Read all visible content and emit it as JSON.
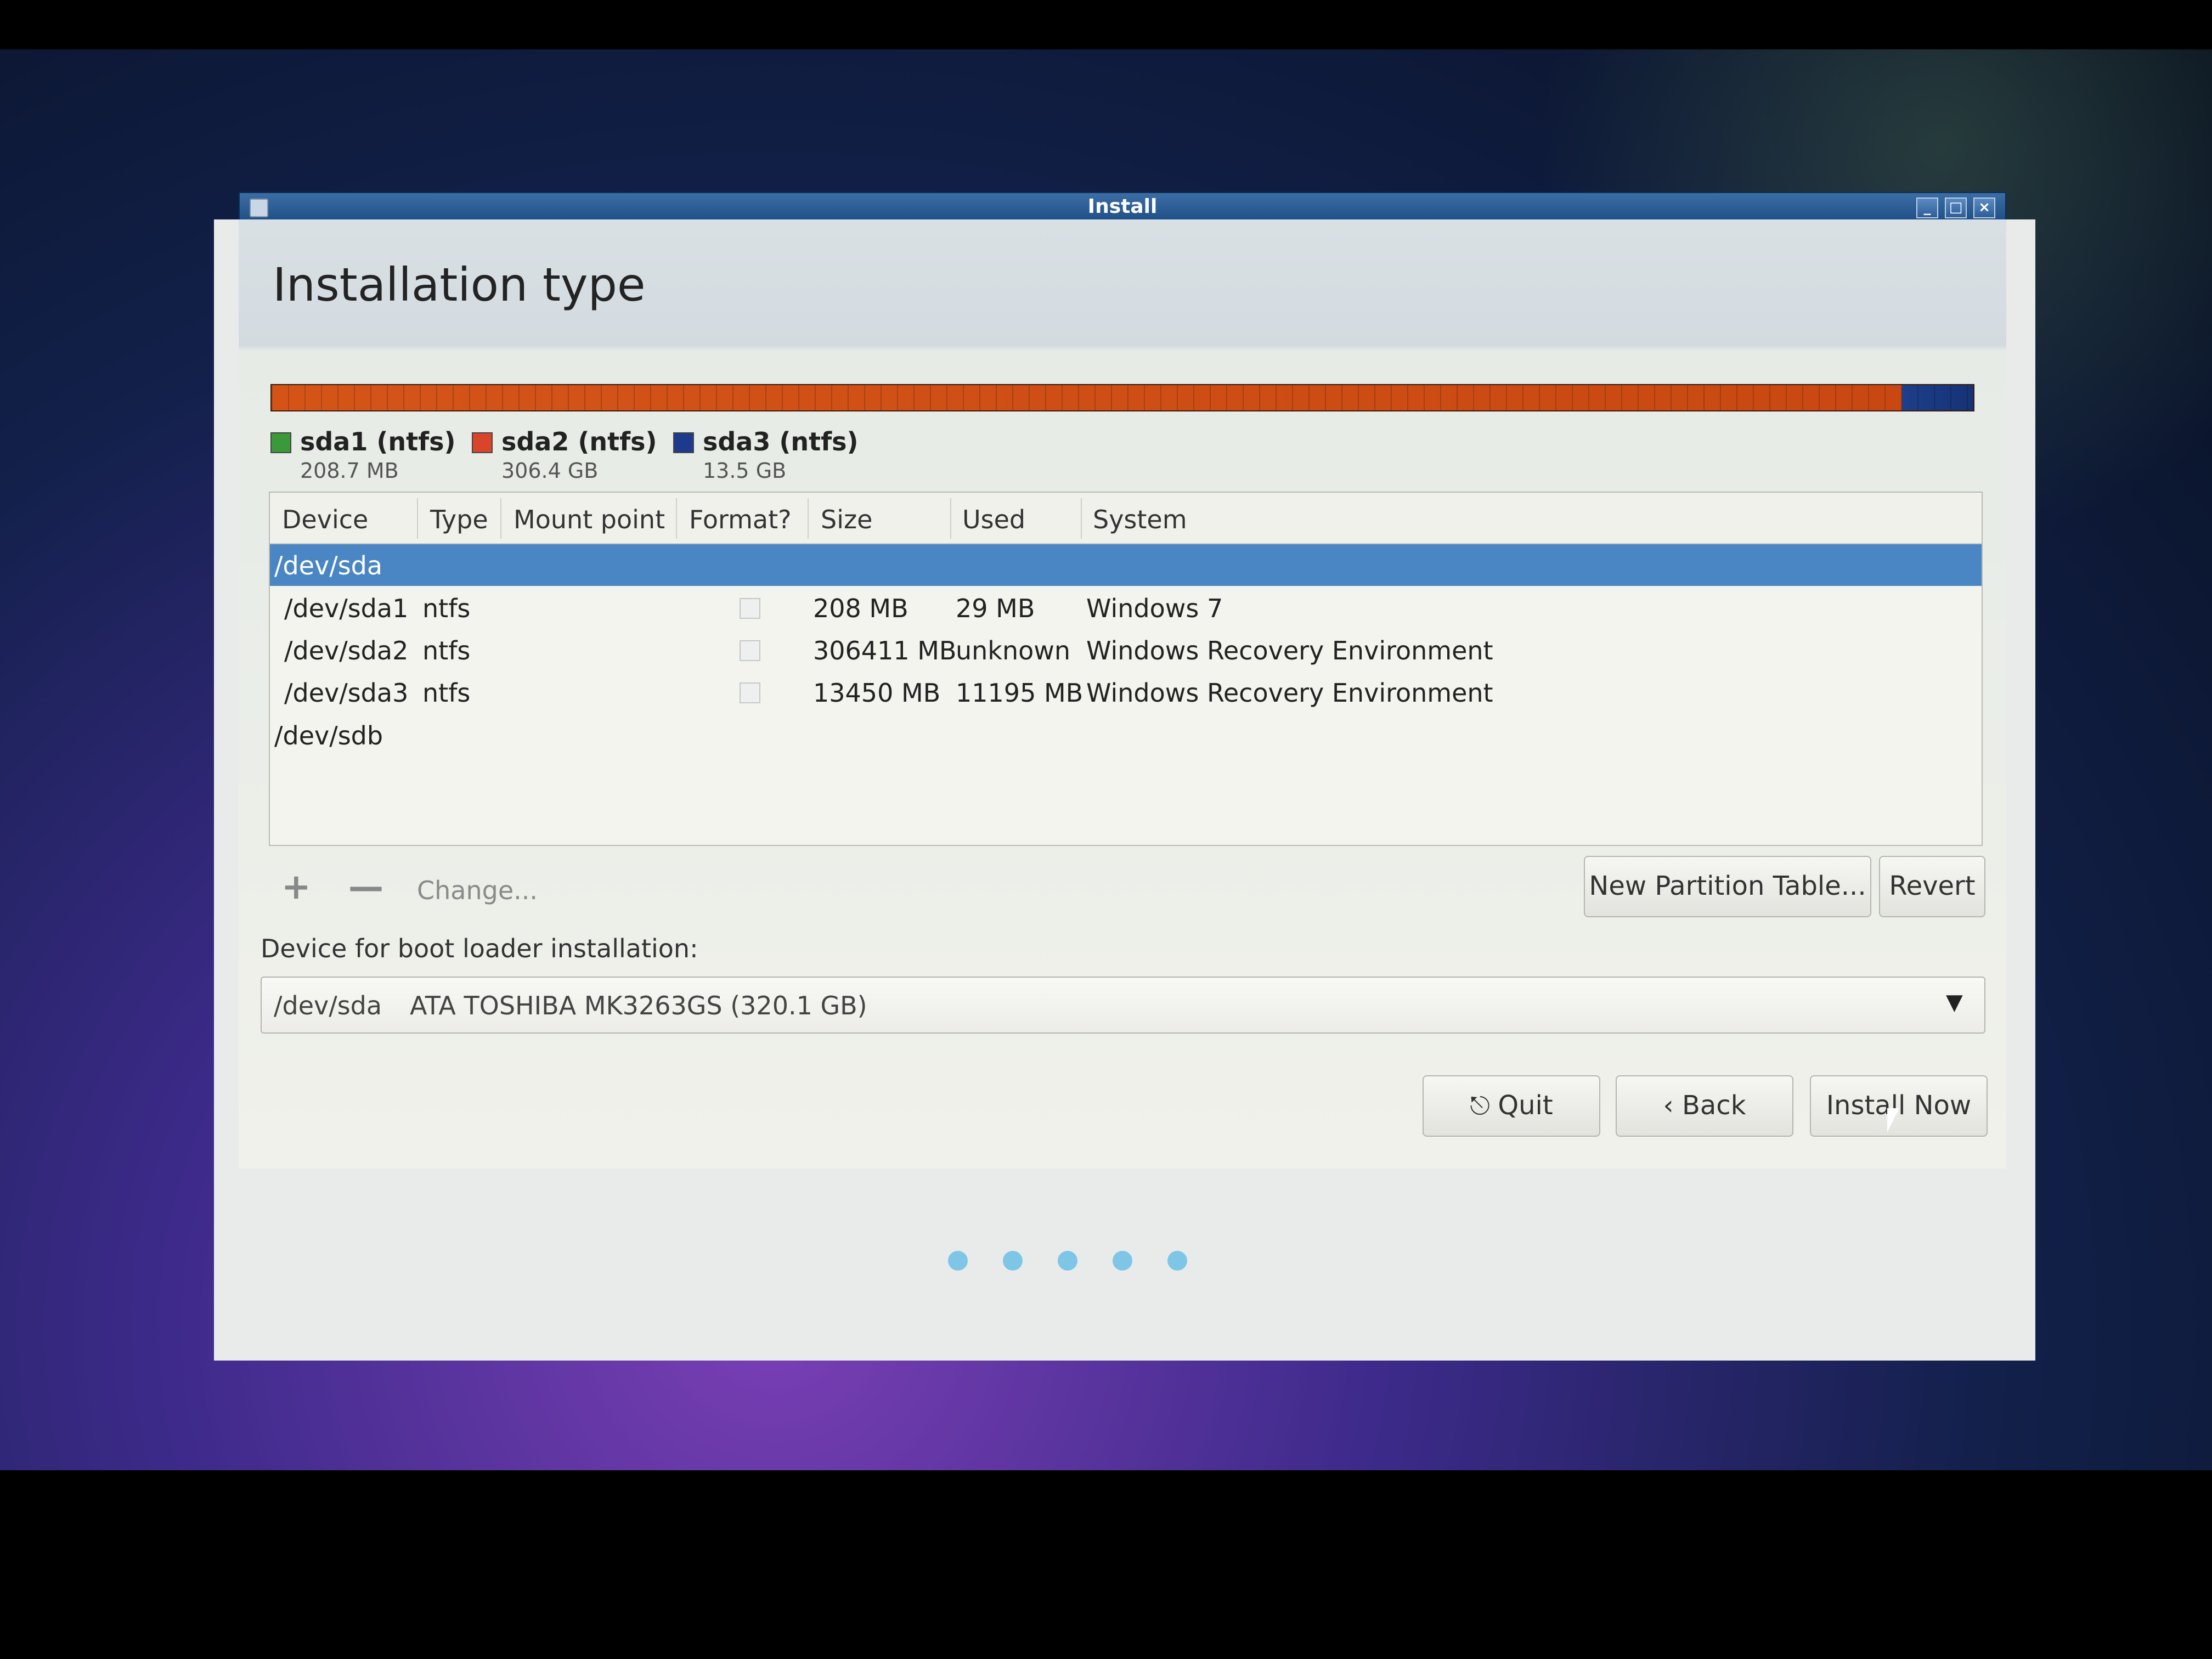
{
  "window": {
    "title": "Install"
  },
  "page": {
    "title": "Installation type"
  },
  "partitions": [
    {
      "name": "sda1 (ntfs)",
      "size": "208.7 MB",
      "color": "#3a9a3a"
    },
    {
      "name": "sda2 (ntfs)",
      "size": "306.4 GB",
      "color": "#d9452b"
    },
    {
      "name": "sda3 (ntfs)",
      "size": "13.5 GB",
      "color": "#1d3a8c"
    }
  ],
  "table": {
    "headers": [
      "Device",
      "Type",
      "Mount point",
      "Format?",
      "Size",
      "Used",
      "System"
    ],
    "disks": [
      {
        "device": "/dev/sda"
      },
      {
        "device": "/dev/sdb"
      }
    ],
    "rows": [
      {
        "device": "/dev/sda1",
        "type": "ntfs",
        "size": "208 MB",
        "used": "29 MB",
        "system": "Windows 7"
      },
      {
        "device": "/dev/sda2",
        "type": "ntfs",
        "size": "306411 MB",
        "used": "unknown",
        "system": "Windows Recovery Environment"
      },
      {
        "device": "/dev/sda3",
        "type": "ntfs",
        "size": "13450 MB",
        "used": "11195 MB",
        "system": "Windows Recovery Environment"
      }
    ]
  },
  "toolbar": {
    "add": "+",
    "remove": "—",
    "change": "Change...",
    "new_partition_table": "New Partition Table...",
    "revert": "Revert"
  },
  "bootloader": {
    "label": "Device for boot loader installation:",
    "device": "/dev/sda",
    "description": "ATA TOSHIBA MK3263GS (320.1 GB)"
  },
  "buttons": {
    "quit": "Quit",
    "back": "Back",
    "install": "Install Now"
  },
  "progress": {
    "steps": 5
  }
}
